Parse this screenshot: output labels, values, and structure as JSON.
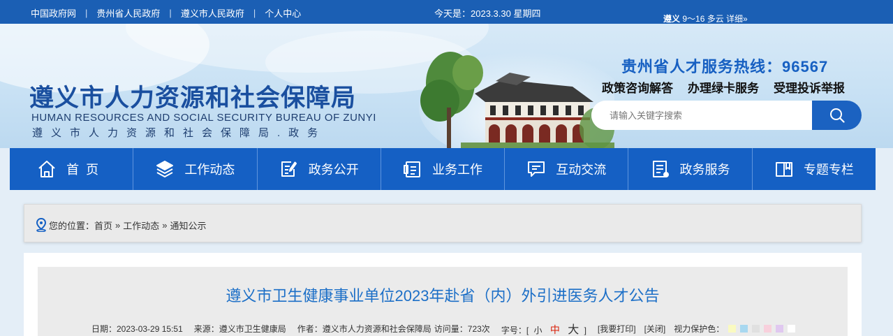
{
  "topbar": {
    "links": [
      "中国政府网",
      "贵州省人民政府",
      "遵义市人民政府",
      "个人中心"
    ],
    "separator": "|",
    "today": "今天是：2023.3.30  星期四",
    "weather_city": "遵义",
    "weather_info": " 9～16 多云 详细»"
  },
  "header": {
    "title": "遵义市人力资源和社会保障局",
    "english": "HUMAN RESOURCES AND SOCIAL SECURITY BUREAU OF ZUNYI",
    "subtitle": "遵义市人力资源和社会保障局.政务",
    "hotline": "贵州省人才服务热线：96567",
    "quick_links": [
      "政策咨询解答",
      "办理绿卡服务",
      "受理投诉举报"
    ],
    "search_placeholder": "请输入关键字搜索"
  },
  "nav": {
    "items": [
      {
        "label": "首页",
        "icon": "home-icon"
      },
      {
        "label": "工作动态",
        "icon": "layers-icon"
      },
      {
        "label": "政务公开",
        "icon": "document-edit-icon"
      },
      {
        "label": "业务工作",
        "icon": "clipboard-icon"
      },
      {
        "label": "互动交流",
        "icon": "chat-icon"
      },
      {
        "label": "政务服务",
        "icon": "list-doc-icon"
      },
      {
        "label": "专题专栏",
        "icon": "book-icon"
      }
    ]
  },
  "breadcrumb": {
    "prefix": "您的位置：",
    "items": [
      "首页",
      "工作动态",
      "通知公示"
    ],
    "arrow": "»"
  },
  "article": {
    "title": "遵义市卫生健康事业单位2023年赴省（内）外引进医务人才公告",
    "date": "日期：2023-03-29 15:51",
    "source": "来源：遵义市卫生健康局",
    "author": "作者：遵义市人力资源和社会保障局",
    "visits": "访问量：723次",
    "font_label": "字号：[",
    "font_small": "小",
    "font_medium": "中",
    "font_large": "大",
    "font_close": "]",
    "print": "[我要打印]",
    "close": "[关闭]",
    "eye_label": "视力保护色：",
    "eye_colors": [
      "#fafac0",
      "#a8d8f0",
      "#e0e0e0",
      "#f8d0dc",
      "#e0c8f0",
      "#ffffff"
    ]
  },
  "colors": {
    "primary_blue": "#1560c4",
    "title_blue": "#1c6fc7",
    "accent_red": "#d81e06"
  }
}
